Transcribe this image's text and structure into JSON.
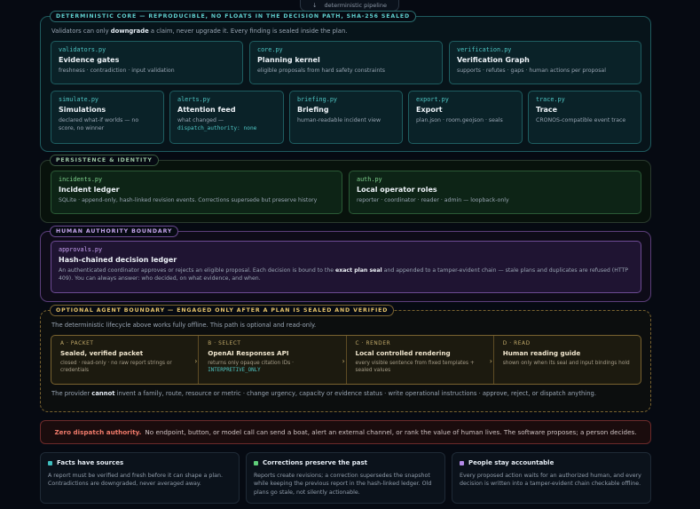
{
  "top": {
    "arrow": "↓",
    "label": "deterministic pipeline"
  },
  "deterministic": {
    "label": "DETERMINISTIC CORE — REPRODUCIBLE, NO FLOATS IN THE DECISION PATH, SHA-256 SEALED",
    "note_pre": "Validators can only ",
    "note_bold": "downgrade",
    "note_post": " a claim, never upgrade it. Every finding is sealed inside the plan.",
    "cards": [
      {
        "file": "validators.py",
        "title": "Evidence gates",
        "desc": "freshness · contradiction · input validation"
      },
      {
        "file": "core.py",
        "title": "Planning kernel",
        "desc": "eligible proposals from hard safety constraints"
      },
      {
        "file": "verification.py",
        "title": "Verification Graph",
        "desc": "supports · refutes · gaps · human actions per proposal"
      },
      {
        "file": "simulate.py",
        "title": "Simulations",
        "desc": "declared what-if worlds — no score, no winner"
      },
      {
        "file": "alerts.py",
        "title": "Attention feed",
        "desc": "what changed —",
        "code": "dispatch_authority: none"
      },
      {
        "file": "briefing.py",
        "title": "Briefing",
        "desc": "human-readable incident view"
      },
      {
        "file": "export.py",
        "title": "Export",
        "desc": "plan.json · room.geojson · seals"
      },
      {
        "file": "trace.py",
        "title": "Trace",
        "desc": "CRONOS-compatible event trace"
      }
    ]
  },
  "persistence": {
    "label": "PERSISTENCE & IDENTITY",
    "cards": [
      {
        "file": "incidents.py",
        "title": "Incident ledger",
        "desc": "SQLite · append-only, hash-linked revision events. Corrections supersede but preserve history"
      },
      {
        "file": "auth.py",
        "title": "Local operator roles",
        "desc": "reporter · coordinator · reader · admin — loopback-only"
      }
    ]
  },
  "human": {
    "label": "HUMAN AUTHORITY BOUNDARY",
    "card": {
      "file": "approvals.py",
      "title": "Hash-chained decision ledger",
      "desc_pre": "An authenticated coordinator approves or rejects an eligible proposal. Each decision is bound to the ",
      "desc_bold": "exact plan seal",
      "desc_post": " and appended to a tamper-evident chain — stale plans and duplicates are refused (HTTP 409). You can always answer: who decided, on what evidence, and when."
    }
  },
  "agent": {
    "label": "OPTIONAL AGENT BOUNDARY — ENGAGED ONLY AFTER A PLAN IS SEALED AND VERIFIED",
    "note": "The deterministic lifecycle above works fully offline. This path is optional and read-only.",
    "steps": [
      {
        "key": "A · PACKET",
        "title": "Sealed, verified packet",
        "desc": "closed · read-only · no raw report strings or credentials"
      },
      {
        "key": "B · SELECT",
        "title": "OpenAI Responses API",
        "desc": "returns only opaque citation IDs ·",
        "code": "INTERPRETIVE_ONLY"
      },
      {
        "key": "C · RENDER",
        "title": "Local controlled rendering",
        "desc": "every visible sentence from fixed templates + sealed values"
      },
      {
        "key": "D · READ",
        "title": "Human reading guide",
        "desc": "shown only when its seal and input bindings hold"
      }
    ],
    "arrow": "›",
    "foot_pre": "The provider ",
    "foot_bold": "cannot",
    "foot_post": " invent a family, route, resource or metric · change urgency, capacity or evidence status · write operational instructions · approve, reject, or dispatch anything."
  },
  "warning": {
    "bold": "Zero dispatch authority.",
    "text": "No endpoint, button, or model call can send a boat, alert an external channel, or rank the value of human lives. The software proposes; a person decides."
  },
  "principles": [
    {
      "title": "Facts have sources",
      "color": "#3fbfbf",
      "desc": "A report must be verified and fresh before it can shape a plan. Contradictions are downgraded, never averaged away."
    },
    {
      "title": "Corrections preserve the past",
      "color": "#5fcf7a",
      "desc": "Reports create revisions; a correction supersedes the snapshot while keeping the previous report in the hash-linked ledger. Old plans go stale, not silently actionable."
    },
    {
      "title": "People stay accountable",
      "color": "#b48ae8",
      "desc": "Every proposed action waits for an authorized human, and every decision is written into a tamper-evident chain checkable offline."
    }
  ]
}
